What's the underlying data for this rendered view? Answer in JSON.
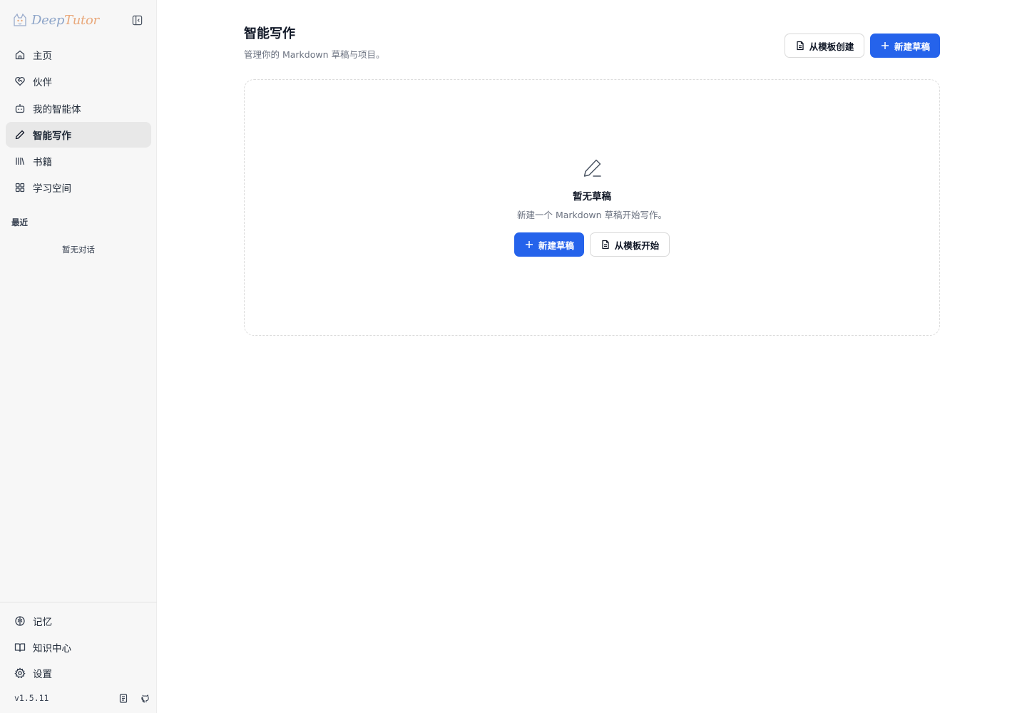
{
  "app": {
    "brand_deep": "Deep",
    "brand_tutor": "Tutor",
    "brand_accent": "#e9a97c",
    "primary_color": "#2563eb"
  },
  "sidebar": {
    "items": [
      {
        "label": "主页",
        "icon": "home-icon"
      },
      {
        "label": "伙伴",
        "icon": "heart-handshake-icon"
      },
      {
        "label": "我的智能体",
        "icon": "bot-icon"
      },
      {
        "label": "智能写作",
        "icon": "pencil-icon",
        "active": true
      },
      {
        "label": "书籍",
        "icon": "library-icon"
      },
      {
        "label": "学习空间",
        "icon": "grid-icon"
      }
    ],
    "recent_label": "最近",
    "recent_empty": "暂无对话",
    "bottom_items": [
      {
        "label": "记忆",
        "icon": "brain-icon"
      },
      {
        "label": "知识中心",
        "icon": "book-open-icon"
      },
      {
        "label": "设置",
        "icon": "gear-icon"
      }
    ],
    "version": "v1.5.11"
  },
  "main": {
    "title": "智能写作",
    "subtitle": "管理你的 Markdown 草稿与项目。",
    "header_template_button": "从模板创建",
    "header_new_button": "新建草稿",
    "empty": {
      "title": "暂无草稿",
      "description": "新建一个 Markdown 草稿开始写作。",
      "new_button": "新建草稿",
      "template_button": "从模板开始"
    }
  }
}
